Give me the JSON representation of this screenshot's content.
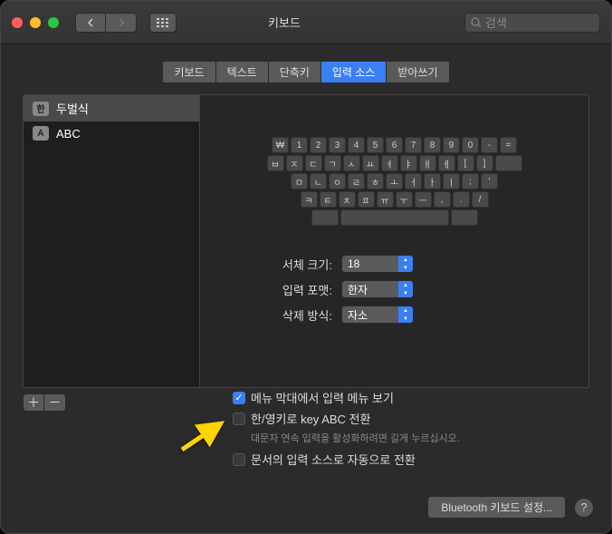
{
  "window": {
    "title": "키보드"
  },
  "search": {
    "placeholder": "검색"
  },
  "tabs": [
    "키보드",
    "텍스트",
    "단축키",
    "입력 소스",
    "받아쓰기"
  ],
  "active_tab_index": 3,
  "sources": [
    {
      "badge": "한",
      "label": "두벌식",
      "selected": true
    },
    {
      "badge": "A",
      "label": "ABC",
      "selected": false
    }
  ],
  "keyboard_rows": [
    [
      "₩",
      "1",
      "2",
      "3",
      "4",
      "5",
      "6",
      "7",
      "8",
      "9",
      "0",
      "-",
      "="
    ],
    [
      "ㅂ",
      "ㅈ",
      "ㄷ",
      "ㄱ",
      "ㅅ",
      "ㅛ",
      "ㅕ",
      "ㅑ",
      "ㅐ",
      "ㅔ",
      "[",
      "]"
    ],
    [
      "ㅁ",
      "ㄴ",
      "ㅇ",
      "ㄹ",
      "ㅎ",
      "ㅗ",
      "ㅓ",
      "ㅏ",
      "ㅣ",
      ";",
      "'"
    ],
    [
      "ㅋ",
      "ㅌ",
      "ㅊ",
      "ㅍ",
      "ㅠ",
      "ㅜ",
      "ㅡ",
      ",",
      ".",
      "/"
    ]
  ],
  "settings": {
    "font_size": {
      "label": "서체 크기:",
      "value": "18"
    },
    "input_format": {
      "label": "입력 포맷:",
      "value": "한자"
    },
    "delete_mode": {
      "label": "삭제 방식:",
      "value": "자소"
    }
  },
  "options": {
    "show_menu": {
      "label": "메뉴 막대에서 입력 메뉴 보기",
      "checked": true
    },
    "toggle_abc": {
      "label": "한/영키로 key ABC 전환",
      "checked": false,
      "hint": "대문자 연속 입력을 활성화하려면 길게 누르십시오."
    },
    "auto_switch": {
      "label": "문서의 입력 소스로 자동으로 전환",
      "checked": false
    }
  },
  "footer": {
    "bluetooth": "Bluetooth 키보드 설정...",
    "help": "?"
  },
  "buttons": {
    "add": "＋",
    "remove": "－"
  }
}
